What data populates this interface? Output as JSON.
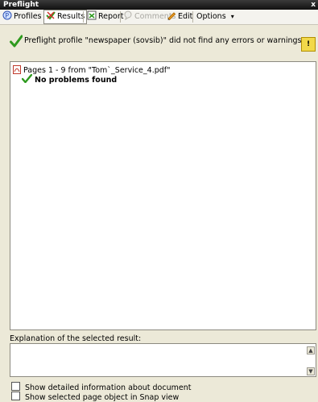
{
  "window": {
    "title": "Preflight",
    "close": "x"
  },
  "toolbar": {
    "profiles": "Profiles",
    "results": "Results",
    "report": "Report",
    "comments": "Comments",
    "edit": "Edit",
    "options": "Options",
    "options_arrow": "▾"
  },
  "message": {
    "text": "Preflight profile \"newspaper (sovsib)\" did not find any errors or warnings:",
    "warning_glyph": "!"
  },
  "results_tree": {
    "file_row": "Pages 1 - 9 from \"Tom`_Service_4.pdf\"",
    "result_row": "No problems found"
  },
  "explanation": {
    "label": "Explanation of the selected result:"
  },
  "options_checkboxes": [
    {
      "label": "Show detailed information about document",
      "checked": false
    },
    {
      "label": "Show selected page object in Snap view",
      "checked": false
    }
  ],
  "colors": {
    "success_green": "#2e9a1e",
    "accent_blue": "#2b4fb5",
    "warning_yellow": "#f2d94a"
  }
}
